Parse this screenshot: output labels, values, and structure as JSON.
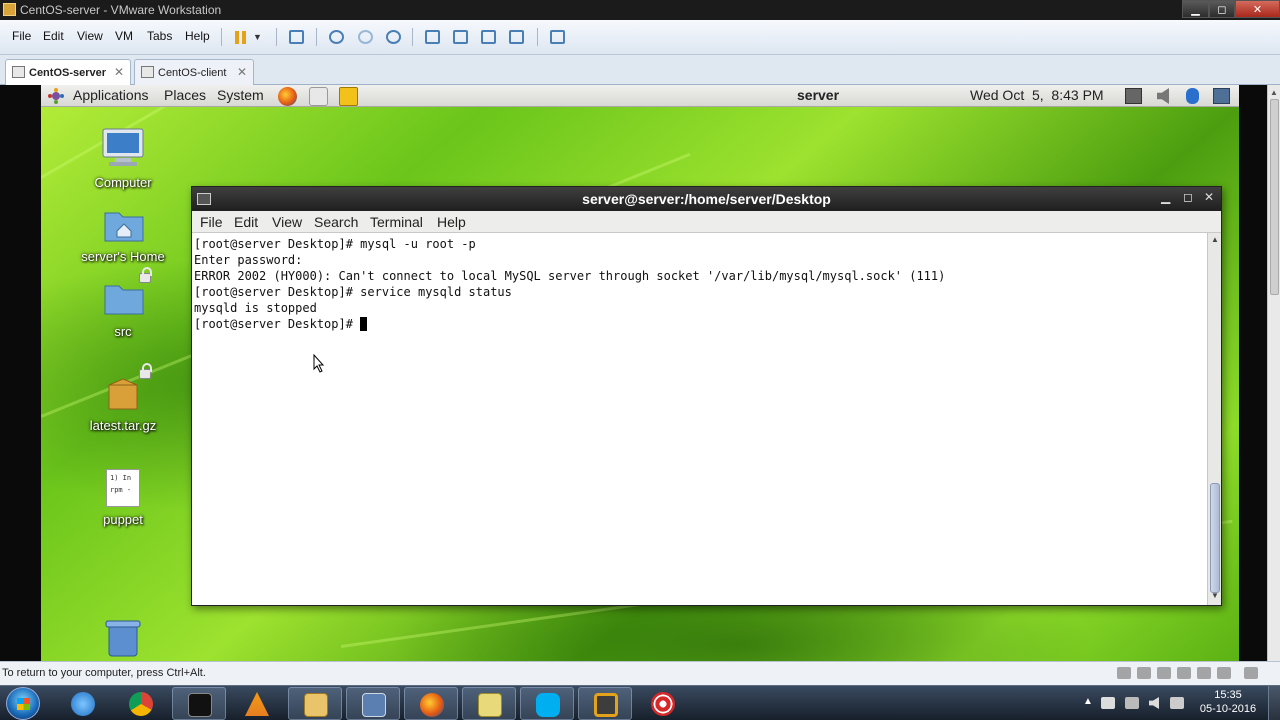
{
  "vmware": {
    "window_title": "CentOS-server - VMware Workstation",
    "menu": [
      "File",
      "Edit",
      "View",
      "VM",
      "Tabs",
      "Help"
    ],
    "tabs": [
      {
        "label": "CentOS-server",
        "active": true
      },
      {
        "label": "CentOS-client",
        "active": false
      }
    ],
    "status_message": "To return to your computer, press Ctrl+Alt."
  },
  "guest": {
    "panel": {
      "menus": [
        "Applications",
        "Places",
        "System"
      ],
      "hostname": "server",
      "clock": "Wed Oct  5,  8:43 PM"
    },
    "desktop_icons": [
      {
        "label": "Computer",
        "icon": "computer-icon"
      },
      {
        "label": "server's Home",
        "icon": "home-folder-icon"
      },
      {
        "label": "src",
        "icon": "folder-icon"
      },
      {
        "label": "latest.tar.gz",
        "icon": "archive-icon"
      },
      {
        "label": "puppet",
        "icon": "text-file-icon",
        "preview": "1) In\nrpm -"
      },
      {
        "label": "",
        "icon": "trash-icon"
      }
    ]
  },
  "terminal": {
    "title": "server@server:/home/server/Desktop",
    "menu": [
      "File",
      "Edit",
      "View",
      "Search",
      "Terminal",
      "Help"
    ],
    "lines": [
      "[root@server Desktop]# mysql -u root -p",
      "Enter password:",
      "ERROR 2002 (HY000): Can't connect to local MySQL server through socket '/var/lib/mysql/mysql.sock' (111)",
      "[root@server Desktop]# service mysqld status",
      "mysqld is stopped",
      "[root@server Desktop]# "
    ]
  },
  "taskbar": {
    "apps": [
      "internet-explorer-icon",
      "chrome-icon",
      "cmd-icon",
      "vlc-icon",
      "explorer-icon",
      "network-icon",
      "firefox-icon",
      "notes-icon",
      "skype-icon",
      "vmware-icon",
      "screen-recorder-icon"
    ],
    "time": "15:35",
    "date": "05-10-2016"
  },
  "colors": {
    "terminal_title_bg": "#2b2b2b",
    "desktop_green": "#6bc51b",
    "taskbar_bg": "#1f2a38"
  }
}
